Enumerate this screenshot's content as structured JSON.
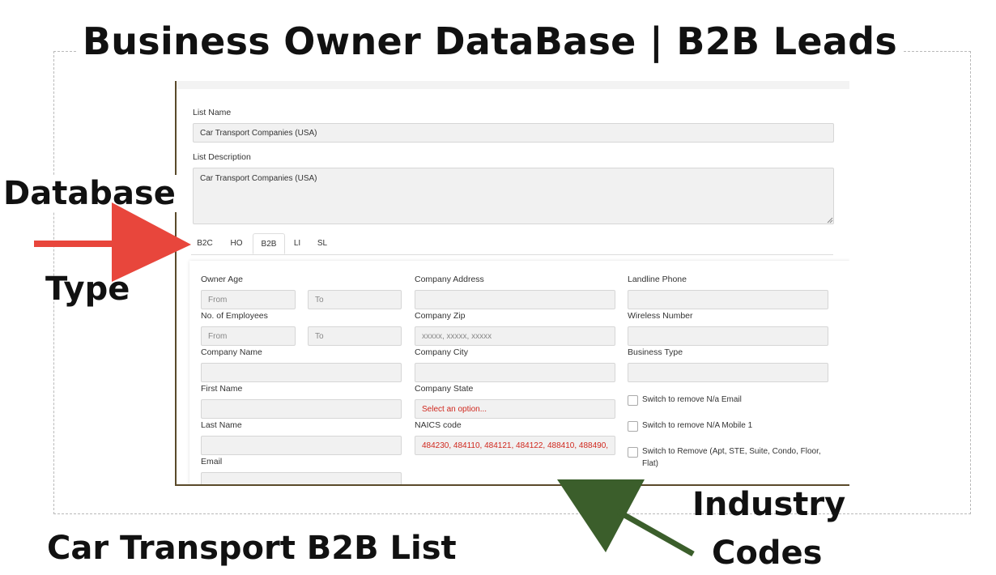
{
  "banner": {
    "title": "Business Owner DataBase | B2B Leads",
    "database_label": "Database",
    "type_label": "Type",
    "footer_label": "Car Transport B2B List",
    "industry_label": "Industry",
    "codes_label": "Codes"
  },
  "colors": {
    "red_arrow": "#e8463c",
    "green_arrow": "#3b5e2b",
    "required_text": "#d0281e"
  },
  "form": {
    "list_name_label": "List Name",
    "list_name_value": "Car Transport Companies (USA)",
    "list_description_label": "List Description",
    "list_description_value": "Car Transport Companies (USA)",
    "tabs": [
      "B2C",
      "HO",
      "B2B",
      "LI",
      "SL"
    ],
    "active_tab": "B2B",
    "owner_age_label": "Owner Age",
    "owner_age_from": "From",
    "owner_age_to": "To",
    "employees_label": "No. of Employees",
    "employees_from": "From",
    "employees_to": "To",
    "company_name_label": "Company Name",
    "first_name_label": "First Name",
    "last_name_label": "Last Name",
    "email_label": "Email",
    "company_address_label": "Company Address",
    "company_zip_label": "Company Zip",
    "company_zip_placeholder": "xxxxx, xxxxx, xxxxx",
    "company_city_label": "Company City",
    "company_state_label": "Company State",
    "company_state_value": "Select an option...",
    "naics_label": "NAICS code",
    "naics_value": "484230, 484110, 484121, 484122, 488410, 488490,",
    "landline_label": "Landline Phone",
    "wireless_label": "Wireless Number",
    "business_type_label": "Business Type",
    "switch_email": "Switch to remove N/a Email",
    "switch_mobile": "Switch to remove N/A Mobile 1",
    "switch_address_line1": "Switch to Remove (Apt, STE, Suite, Condo, Floor,",
    "switch_address_line2": "Flat)"
  }
}
